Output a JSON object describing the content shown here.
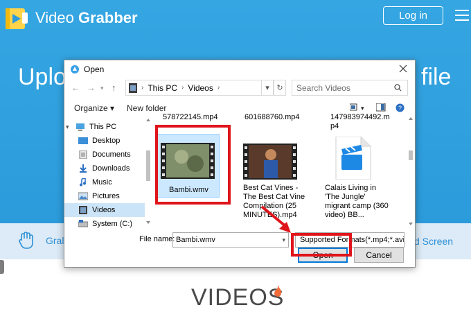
{
  "site": {
    "brand_prefix": "Video",
    "brand_suffix": "Grabber",
    "login_label": "Log in",
    "hero_left": "Uplo",
    "hero_right": "file",
    "feature_left": "Gral",
    "feature_right": "d Screen",
    "section_title": "VIDEOS",
    "colors": {
      "header_bg": "#2c9bdb",
      "feature_bg": "#dcebf7",
      "highlight": "#e0141b"
    }
  },
  "dialog": {
    "title": "Open",
    "breadcrumb": [
      "This PC",
      "Videos"
    ],
    "search_placeholder": "Search Videos",
    "toolbar": {
      "organize": "Organize ▾",
      "new_folder": "New folder"
    },
    "sidebar": [
      {
        "label": "This PC",
        "icon": "computer-icon"
      },
      {
        "label": "Desktop",
        "icon": "desktop-folder-icon"
      },
      {
        "label": "Documents",
        "icon": "documents-folder-icon"
      },
      {
        "label": "Downloads",
        "icon": "downloads-folder-icon"
      },
      {
        "label": "Music",
        "icon": "music-folder-icon"
      },
      {
        "label": "Pictures",
        "icon": "pictures-folder-icon"
      },
      {
        "label": "Videos",
        "icon": "videos-folder-icon",
        "selected": true
      },
      {
        "label": "System (C:)",
        "icon": "drive-icon"
      }
    ],
    "files_partial": [
      "578722145.mp4",
      "601688760.mp4",
      "147983974492.m",
      "p4"
    ],
    "files": [
      {
        "name": "Bambi.wmv",
        "selected": true
      },
      {
        "name": "Best Cat Vines - The Best Cat Vine Compilation (25 MINUTES).mp4"
      },
      {
        "name": "Calais Living in 'The Jungle' migrant camp (360 video) BB..."
      }
    ],
    "filename_label": "File name:",
    "filename_value": "Bambi.wmv",
    "filetype_value": "Supported Formats(*.mp4;*.avi;",
    "open_label": "Open",
    "cancel_label": "Cancel"
  }
}
